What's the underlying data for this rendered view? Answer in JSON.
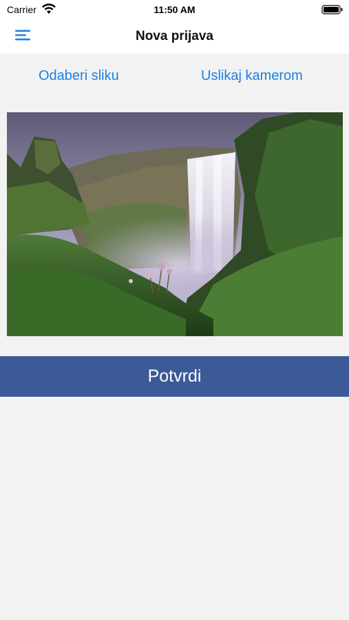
{
  "status_bar": {
    "carrier": "Carrier",
    "time": "11:50 AM",
    "wifi_icon": "wifi-icon",
    "battery_icon": "battery-full-icon"
  },
  "nav": {
    "title": "Nova prijava",
    "menu_icon": "hamburger-menu-icon"
  },
  "image_source": {
    "gallery_label": "Odaberi sliku",
    "camera_label": "Uslikaj kamerom"
  },
  "photo": {
    "subject": "waterfall landscape"
  },
  "confirm": {
    "label": "Potvrdi"
  },
  "colors": {
    "accent_link": "#1a82e2",
    "confirm_bg": "#3d5a98",
    "background": "#f2f2f2"
  }
}
